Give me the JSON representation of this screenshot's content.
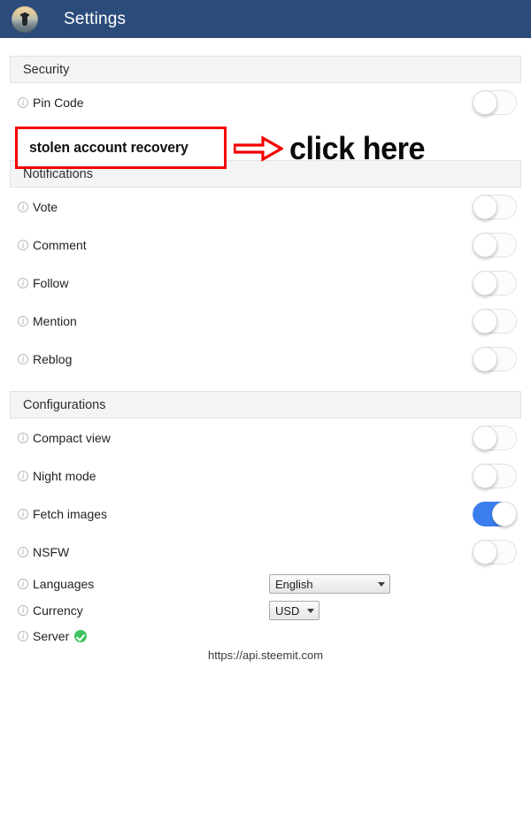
{
  "appbar": {
    "title": "Settings",
    "avatar_alt": "user-avatar",
    "background_color": "#2b4c7b"
  },
  "sections": [
    {
      "id": "security",
      "header": "Security",
      "rows": [
        {
          "id": "pin-code",
          "label": "Pin Code",
          "control": "toggle",
          "state": "off"
        }
      ]
    },
    {
      "id": "notifications",
      "header": "Notifications",
      "rows": [
        {
          "id": "vote",
          "label": "Vote",
          "control": "toggle",
          "state": "off"
        },
        {
          "id": "comment",
          "label": "Comment",
          "control": "toggle",
          "state": "off"
        },
        {
          "id": "follow",
          "label": "Follow",
          "control": "toggle",
          "state": "off"
        },
        {
          "id": "mention",
          "label": "Mention",
          "control": "toggle",
          "state": "off"
        },
        {
          "id": "reblog",
          "label": "Reblog",
          "control": "toggle",
          "state": "off"
        }
      ]
    },
    {
      "id": "configurations",
      "header": "Configurations",
      "rows": [
        {
          "id": "compact-view",
          "label": "Compact view",
          "control": "toggle",
          "state": "off"
        },
        {
          "id": "night-mode",
          "label": "Night mode",
          "control": "toggle",
          "state": "off"
        },
        {
          "id": "fetch-images",
          "label": "Fetch images",
          "control": "toggle",
          "state": "on"
        },
        {
          "id": "nsfw",
          "label": "NSFW",
          "control": "toggle",
          "state": "off"
        },
        {
          "id": "languages",
          "label": "Languages",
          "control": "select",
          "value": "English"
        },
        {
          "id": "currency",
          "label": "Currency",
          "control": "select",
          "value": "USD"
        },
        {
          "id": "server",
          "label": "Server",
          "control": "status",
          "status": "verified"
        }
      ]
    }
  ],
  "server": {
    "url": "https://api.steemit.com",
    "status_color": "#3fc462"
  },
  "annotation": {
    "box_text": "stolen account recovery",
    "callout_text": "click here",
    "arrow_color": "#f40000",
    "box_border_color": "#f40000"
  },
  "colors": {
    "toggle_on": "#3b7ded",
    "section_band": "#f4f4f4",
    "text": "#232323"
  }
}
